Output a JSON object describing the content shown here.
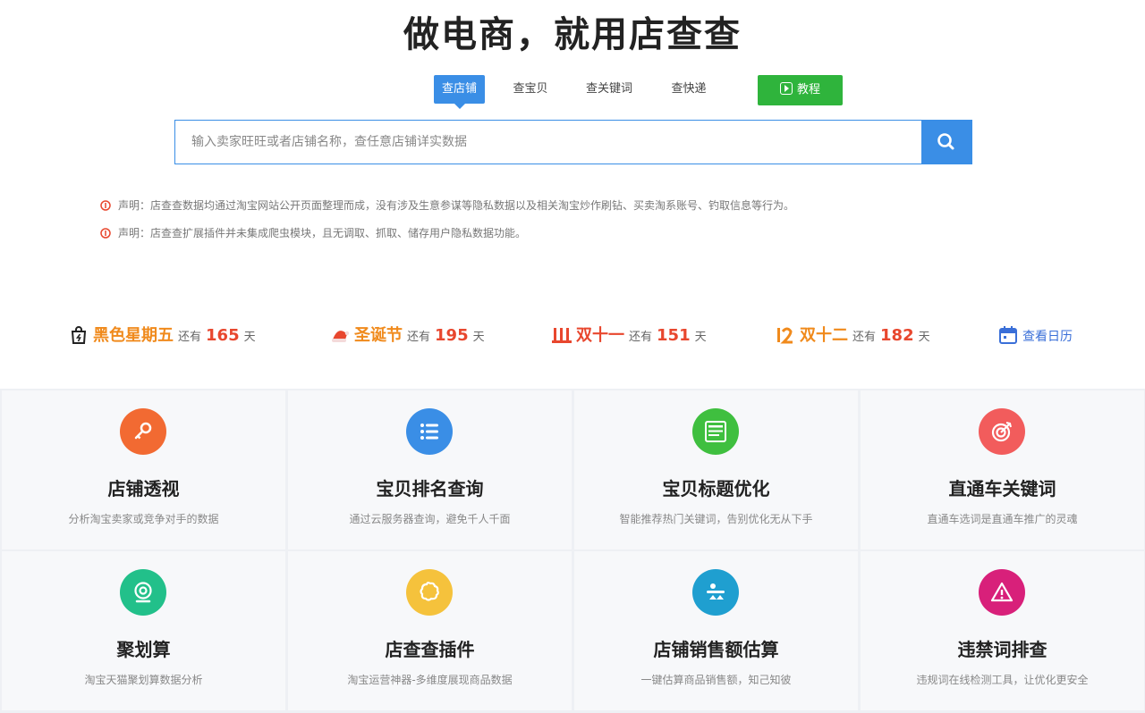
{
  "hero": {
    "title": "做电商，就用店查查"
  },
  "tabs": [
    {
      "label": "查店铺",
      "active": true
    },
    {
      "label": "查宝贝",
      "active": false
    },
    {
      "label": "查关键词",
      "active": false
    },
    {
      "label": "查快递",
      "active": false
    }
  ],
  "tutorial_button": {
    "label": "教程",
    "color": "#2fb43c"
  },
  "search": {
    "placeholder": "输入卖家旺旺或者店铺名称，查任意店铺详实数据",
    "value": "",
    "button_icon": "search-icon",
    "accent": "#3a8ee6"
  },
  "notices": [
    "声明：店查查数据均通过淘宝网站公开页面整理而成，没有涉及生意参谋等隐私数据以及相关淘宝炒作刷钻、买卖淘系账号、钓取信息等行为。",
    "声明：店查查扩展插件并未集成爬虫模块，且无调取、抓取、储存用户隐私数据功能。"
  ],
  "countdowns": [
    {
      "name": "黑色星期五",
      "prefix": "还有",
      "days": "165",
      "unit": "天",
      "color": "#f08a1c",
      "icon": "shopping-bag-icon"
    },
    {
      "name": "圣诞节",
      "prefix": "还有",
      "days": "195",
      "unit": "天",
      "color": "#f08a1c",
      "icon": "santa-hat-icon"
    },
    {
      "name": "双十一",
      "prefix": "还有",
      "days": "151",
      "unit": "天",
      "color": "#e8472e",
      "icon": "double-eleven-icon"
    },
    {
      "name": "双十二",
      "prefix": "还有",
      "days": "182",
      "unit": "天",
      "color": "#f08a1c",
      "icon": "double-twelve-icon"
    }
  ],
  "calendar_link": {
    "label": "查看日历",
    "icon": "calendar-icon"
  },
  "features": [
    {
      "title": "店铺透视",
      "desc": "分析淘宝卖家或竞争对手的数据",
      "color": "#f26a32",
      "icon": "key-icon"
    },
    {
      "title": "宝贝排名查询",
      "desc": "通过云服务器查询，避免千人千面",
      "color": "#3a8ee6",
      "icon": "list-icon"
    },
    {
      "title": "宝贝标题优化",
      "desc": "智能推荐热门关键词，告别优化无从下手",
      "color": "#3fbf3f",
      "icon": "title-icon"
    },
    {
      "title": "直通车关键词",
      "desc": "直通车选词是直通车推广的灵魂",
      "color": "#f25c5c",
      "icon": "target-icon"
    },
    {
      "title": "聚划算",
      "desc": "淘宝天猫聚划算数据分析",
      "color": "#22c08a",
      "icon": "webcam-icon"
    },
    {
      "title": "店查查插件",
      "desc": "淘宝运营神器-多维度展现商品数据",
      "color": "#f5c23c",
      "icon": "puzzle-icon"
    },
    {
      "title": "店铺销售额估算",
      "desc": "一键估算商品销售额，知己知彼",
      "color": "#1f9fd0",
      "icon": "scale-icon"
    },
    {
      "title": "违禁词排查",
      "desc": "违规词在线检测工具，让优化更安全",
      "color": "#d8207a",
      "icon": "warning-icon"
    }
  ]
}
